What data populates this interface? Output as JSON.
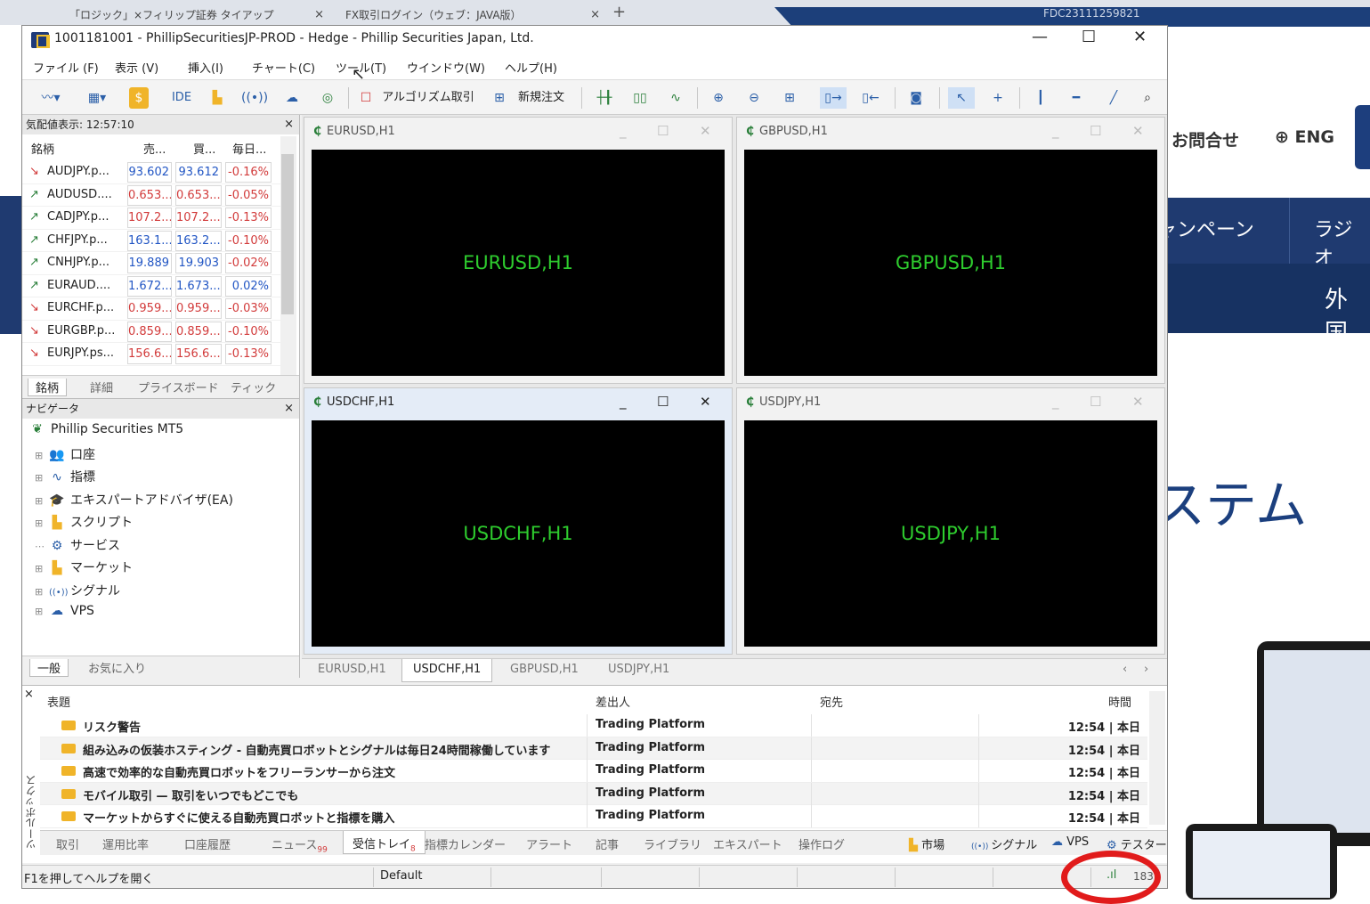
{
  "browser": {
    "tabs": [
      {
        "label": "「ロジック」×フィリップ証券 タイアップ"
      },
      {
        "label": "FX取引ログイン（ウェブ：JAVA版）"
      }
    ],
    "id_text": "FDC23111259821"
  },
  "background_site": {
    "inquiry": "お問合せ",
    "lang": "⊕ ENG",
    "nav_campaign": "ャンペーン",
    "nav_radio": "ラジオ",
    "foreign": "外国",
    "system_heading": "ステム"
  },
  "window": {
    "title": "1001181001 - PhillipSecuritiesJP-PROD - Hedge - Phillip Securities Japan, Ltd."
  },
  "menu": [
    "ファイル (F)",
    "表示 (V)",
    "挿入(I)",
    "チャート(C)",
    "ツール(T)",
    "ウインドウ(W)",
    "ヘルプ(H)"
  ],
  "toolbar": {
    "ide": "IDE",
    "algo": "アルゴリズム取引",
    "new_order": "新規注文"
  },
  "watchlist": {
    "header": "気配値表示: 12:57:10",
    "columns": {
      "symbol": "銘柄",
      "bid": "売...",
      "ask": "買...",
      "daily": "毎日..."
    },
    "rows": [
      {
        "dir": "down",
        "arrow": "↘",
        "symbol": "AUDJPY.p...",
        "bid": "93.602",
        "ask": "93.612",
        "change": "-0.16%",
        "color": "blue"
      },
      {
        "dir": "up",
        "arrow": "↗",
        "symbol": "AUDUSD....",
        "bid": "0.653...",
        "ask": "0.653...",
        "change": "-0.05%",
        "color": "red"
      },
      {
        "dir": "up",
        "arrow": "↗",
        "symbol": "CADJPY.p...",
        "bid": "107.2...",
        "ask": "107.2...",
        "change": "-0.13%",
        "color": "red"
      },
      {
        "dir": "up",
        "arrow": "↗",
        "symbol": "CHFJPY.p...",
        "bid": "163.1...",
        "ask": "163.2...",
        "change": "-0.10%",
        "color": "blue"
      },
      {
        "dir": "up",
        "arrow": "↗",
        "symbol": "CNHJPY.p...",
        "bid": "19.889",
        "ask": "19.903",
        "change": "-0.02%",
        "color": "blue"
      },
      {
        "dir": "up",
        "arrow": "↗",
        "symbol": "EURAUD....",
        "bid": "1.672...",
        "ask": "1.673...",
        "change": "0.02%",
        "color": "blue"
      },
      {
        "dir": "down",
        "arrow": "↘",
        "symbol": "EURCHF.p...",
        "bid": "0.959...",
        "ask": "0.959...",
        "change": "-0.03%",
        "color": "red"
      },
      {
        "dir": "down",
        "arrow": "↘",
        "symbol": "EURGBP.p...",
        "bid": "0.859...",
        "ask": "0.859...",
        "change": "-0.10%",
        "color": "red"
      },
      {
        "dir": "down",
        "arrow": "↘",
        "symbol": "EURJPY.ps...",
        "bid": "156.6...",
        "ask": "156.6...",
        "change": "-0.13%",
        "color": "red"
      }
    ],
    "tabs": [
      "銘柄",
      "詳細",
      "プライスボード",
      "ティック"
    ]
  },
  "navigator": {
    "header": "ナビゲータ",
    "root": "Phillip Securities MT5",
    "items": [
      "口座",
      "指標",
      "エキスパートアドバイザ(EA)",
      "スクリプト",
      "サービス",
      "マーケット",
      "シグナル",
      "VPS"
    ],
    "tabs": [
      "一般",
      "お気に入り"
    ]
  },
  "charts": {
    "windows": [
      {
        "title": "EURUSD,H1",
        "label": "EURUSD,H1"
      },
      {
        "title": "GBPUSD,H1",
        "label": "GBPUSD,H1"
      },
      {
        "title": "USDCHF,H1",
        "label": "USDCHF,H1"
      },
      {
        "title": "USDJPY,H1",
        "label": "USDJPY,H1"
      }
    ],
    "tabs": [
      "EURUSD,H1",
      "USDCHF,H1",
      "GBPUSD,H1",
      "USDJPY,H1"
    ],
    "active_tab": "USDCHF,H1"
  },
  "toolbox": {
    "vertical_label": "ツールボックス",
    "columns": {
      "subject": "表題",
      "from": "差出人",
      "to": "宛先",
      "time": "時間"
    },
    "rows": [
      {
        "subject": "リスク警告",
        "from": "Trading Platform",
        "time": "12:54 | 本日"
      },
      {
        "subject": "組み込みの仮装ホスティング - 自動売買ロボットとシグナルは毎日24時間稼働しています",
        "from": "Trading Platform",
        "time": "12:54 | 本日"
      },
      {
        "subject": "高速で効率的な自動売買ロボットをフリーランサーから注文",
        "from": "Trading Platform",
        "time": "12:54 | 本日"
      },
      {
        "subject": "モバイル取引 — 取引をいつでもどこでも",
        "from": "Trading Platform",
        "time": "12:54 | 本日"
      },
      {
        "subject": "マーケットからすぐに使える自動売買ロボットと指標を購入",
        "from": "Trading Platform",
        "time": "12:54 | 本日"
      }
    ],
    "tabs": [
      {
        "label": "取引"
      },
      {
        "label": "運用比率"
      },
      {
        "label": "口座履歴"
      },
      {
        "label": "ニュース",
        "badge": "99"
      },
      {
        "label": "受信トレイ",
        "badge": "8"
      },
      {
        "label": "指標カレンダー"
      },
      {
        "label": "アラート"
      },
      {
        "label": "記事"
      },
      {
        "label": "ライブラリ"
      },
      {
        "label": "エキスパート"
      },
      {
        "label": "操作ログ"
      }
    ],
    "right_tabs": [
      "市場",
      "シグナル",
      "VPS",
      "テスター"
    ]
  },
  "status": {
    "help": "F1を押してヘルプを開く",
    "profile": "Default",
    "ping": "183"
  },
  "colors": {
    "highlight": "#e11b1b",
    "chart_label": "#2ecc2e",
    "accent": "#1f3b7a"
  }
}
